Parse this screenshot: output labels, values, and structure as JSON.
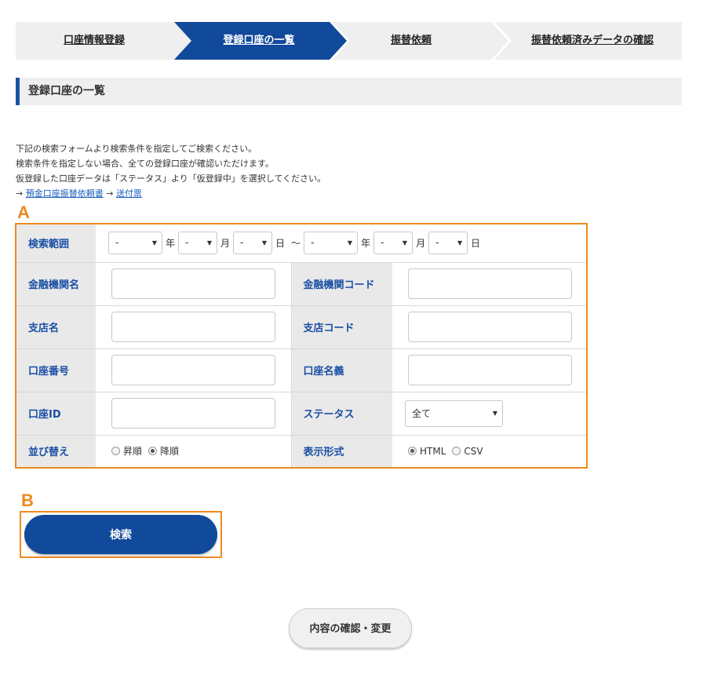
{
  "steps": [
    {
      "label": "口座情報登録",
      "active": false
    },
    {
      "label": "登録口座の一覧",
      "active": true
    },
    {
      "label": "振替依頼",
      "active": false
    },
    {
      "label": "振替依頼済みデータの確認",
      "active": false
    }
  ],
  "section_title": "登録口座の一覧",
  "description": {
    "line1": "下記の検索フォームより検索条件を指定してご検索ください。",
    "line2": "検索条件を指定しない場合、全ての登録口座が確認いただけます。",
    "line3": "仮登録した口座データは「ステータス」より「仮登録中」を選択してください。",
    "arrow1": "→",
    "link1": "預金口座振替依頼書",
    "arrow2": "→",
    "link2": "送付票"
  },
  "marks": {
    "a": "A",
    "b": "B"
  },
  "form": {
    "search_range_label": "検索範囲",
    "date": {
      "from_year": "-",
      "from_month": "-",
      "from_day": "-",
      "to_year": "-",
      "to_month": "-",
      "to_day": "-",
      "year_unit": "年",
      "month_unit": "月",
      "day_unit": "日",
      "tilde": "～"
    },
    "bank_name_label": "金融機関名",
    "bank_code_label": "金融機関コード",
    "branch_name_label": "支店名",
    "branch_code_label": "支店コード",
    "account_number_label": "口座番号",
    "account_holder_label": "口座名義",
    "account_id_label": "口座ID",
    "status_label": "ステータス",
    "status_value": "全て",
    "sort_label": "並び替え",
    "sort_options": [
      "昇順",
      "降順"
    ],
    "sort_selected": "降順",
    "format_label": "表示形式",
    "format_options": [
      "HTML",
      "CSV"
    ],
    "format_selected": "HTML"
  },
  "buttons": {
    "search": "検索",
    "confirm": "内容の確認・変更"
  },
  "colors": {
    "primary": "#11499b",
    "accent_orange": "#ee8a1f",
    "label_blue": "#1a4fa5",
    "step_inactive": "#efefef"
  }
}
